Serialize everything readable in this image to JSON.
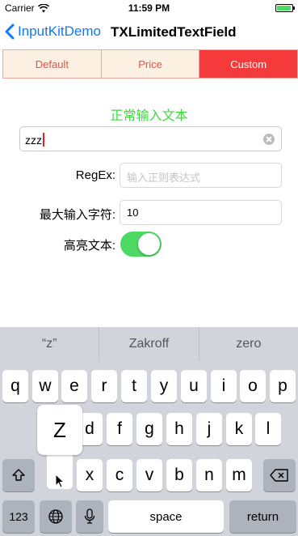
{
  "status_bar": {
    "carrier": "Carrier",
    "time": "11:59 PM"
  },
  "nav": {
    "back_label": "InputKitDemo",
    "title": "TXLimitedTextField"
  },
  "segments": [
    {
      "label": "Default",
      "selected": false
    },
    {
      "label": "Price",
      "selected": false
    },
    {
      "label": "Custom",
      "selected": true
    }
  ],
  "form": {
    "section_title": "正常输入文本",
    "main_input_value": "zzz",
    "regex_label": "RegEx:",
    "regex_placeholder": "输入正则表达式",
    "max_chars_label": "最大输入字符:",
    "max_chars_value": "10",
    "highlight_label": "高亮文本:",
    "highlight_on": true
  },
  "keyboard": {
    "suggestions": [
      "“z”",
      "Zakroff",
      "zero"
    ],
    "row1": [
      "q",
      "w",
      "e",
      "r",
      "t",
      "y",
      "u",
      "i",
      "o",
      "p"
    ],
    "row2": [
      "a",
      "s",
      "d",
      "f",
      "g",
      "h",
      "j",
      "k",
      "l"
    ],
    "row3": [
      "z",
      "x",
      "c",
      "v",
      "b",
      "n",
      "m"
    ],
    "popup_key": "Z",
    "numbers_label": "123",
    "space_label": "space",
    "return_label": "return"
  },
  "colors": {
    "accent_blue": "#0a7bff",
    "segment_red": "#f43a3a",
    "title_green": "#41d840",
    "toggle_green": "#4cd964"
  }
}
